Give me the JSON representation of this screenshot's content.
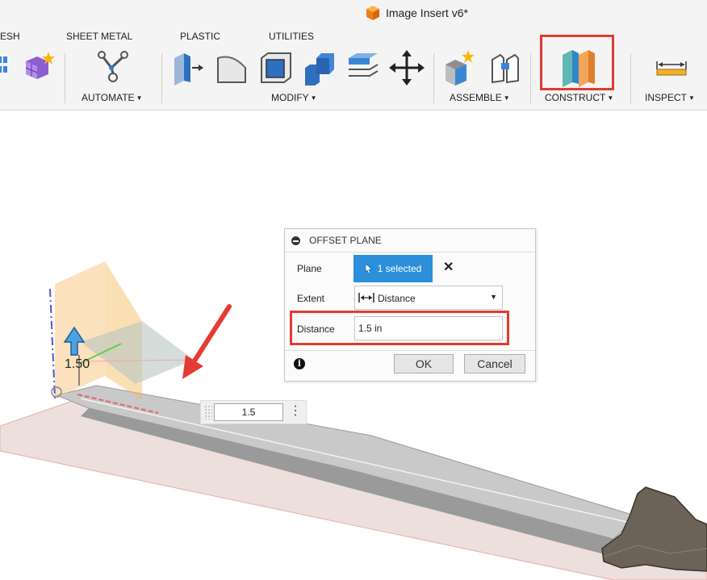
{
  "window": {
    "title": "Image Insert v6*"
  },
  "tabs": [
    "ESH",
    "SHEET METAL",
    "PLASTIC",
    "UTILITIES"
  ],
  "groups": {
    "automate": "AUTOMATE",
    "modify": "MODIFY",
    "assemble": "ASSEMBLE",
    "construct": "CONSTRUCT",
    "inspect": "INSPECT"
  },
  "dialog": {
    "title": "OFFSET PLANE",
    "plane_label": "Plane",
    "plane_selection": "1 selected",
    "extent_label": "Extent",
    "extent_value": "Distance",
    "distance_label": "Distance",
    "distance_value": "1.5 in",
    "ok": "OK",
    "cancel": "Cancel"
  },
  "viewport": {
    "dimension_label": "1.50",
    "inline_value": "1.5"
  },
  "colors": {
    "accent_blue": "#2b8fd9",
    "highlight_red": "#e03c31",
    "plane_orange": "#f5b95b",
    "arrow_blue": "#4aa3e0"
  },
  "icons": {
    "window": "app-cube-icon",
    "construct": "construct-plane-icon",
    "inspect": "measure-ruler-icon",
    "info": "info-icon"
  }
}
